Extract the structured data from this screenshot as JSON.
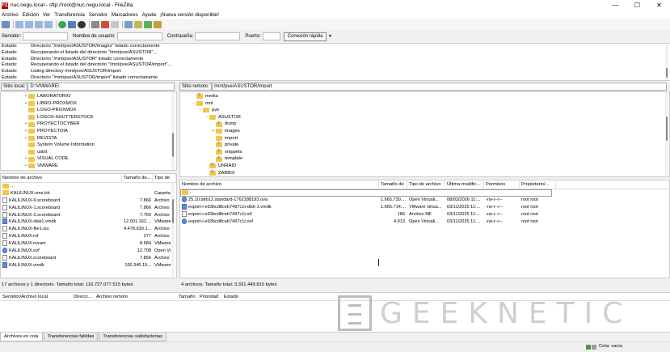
{
  "window": {
    "title": "nuc.negu.local - sftp://root@nuc.negu.local - FileZilla",
    "app_icon": "FZ",
    "minimize": "—",
    "maximize": "☐",
    "close": "✕"
  },
  "menu": [
    "Archivo",
    "Edición",
    "Ver",
    "Transferencia",
    "Servidor",
    "Marcadores",
    "Ayuda",
    "¡Nueva versión disponible!"
  ],
  "quickconnect": {
    "host_label": "Servidor:",
    "user_label": "Nombre de usuario:",
    "pass_label": "Contraseña:",
    "port_label": "Puerto:",
    "button": "Conexión rápida",
    "dropdown": "▼"
  },
  "log": [
    {
      "k": "Estado:",
      "v": "Directorio \"/mnt/pve/ASUSTOR/images\" listado correctamente"
    },
    {
      "k": "Estado:",
      "v": "Recuperando el listado del directorio \"/mnt/pve/ASUSTOR\"..."
    },
    {
      "k": "Estado:",
      "v": "Directorio \"/mnt/pve/ASUSTOR\" listado correctamente"
    },
    {
      "k": "Estado:",
      "v": "Recuperando el listado del directorio \"/mnt/pve/ASUSTOR/import\"..."
    },
    {
      "k": "Estado:",
      "v": "Listing directory /mnt/pve/ASUSTOR/import"
    },
    {
      "k": "Estado:",
      "v": "Directorio \"/mnt/pve/ASUSTOR/import\" listado correctamente"
    }
  ],
  "local": {
    "site_label": "Sitio local:",
    "path": "D:\\VMWARE\\",
    "tree": [
      {
        "name": "LABORATORIO",
        "exp": "+"
      },
      {
        "name": "LIBRO-PROXMOX",
        "exp": "+"
      },
      {
        "name": "LOGO-PROXMOX",
        "exp": ""
      },
      {
        "name": "LOGOS-SHUTTERSTOCK",
        "exp": ""
      },
      {
        "name": "PROYECTOCYBER",
        "exp": "+"
      },
      {
        "name": "PROYECTOIA",
        "exp": "+"
      },
      {
        "name": "REVISTA",
        "exp": "+"
      },
      {
        "name": "System Volume Information",
        "exp": ""
      },
      {
        "name": "usbit",
        "exp": ""
      },
      {
        "name": "VISUAL CODE",
        "exp": "+"
      },
      {
        "name": "VMWARE",
        "exp": "+"
      }
    ],
    "columns": [
      "Nombre de archivo",
      "Tamaño de...",
      "Tipo de"
    ],
    "files": [
      {
        "name": "..",
        "size": "",
        "type": "",
        "icon": "folder"
      },
      {
        "name": "KALILINUX.vmx.lck",
        "size": "",
        "type": "Carpeta",
        "icon": "folder"
      },
      {
        "name": "KALILINUX-0.scoreboard",
        "size": "7.866",
        "type": "Archivo",
        "icon": "file"
      },
      {
        "name": "KALILINUX-1.scoreboard",
        "size": "7.866",
        "type": "Archivo",
        "icon": "file"
      },
      {
        "name": "KALILINUX-2.scoreboard",
        "size": "7.769",
        "type": "Archivo",
        "icon": "file"
      },
      {
        "name": "KALILINUX-disk1.vmdk",
        "size": "12.001.162....",
        "type": "VMware",
        "icon": "disk"
      },
      {
        "name": "KALILINUX-file1.iso",
        "size": "4.478.939.1...",
        "type": "Archivo",
        "icon": "file"
      },
      {
        "name": "KALILINUX.mf",
        "size": "277",
        "type": "Archivo",
        "icon": "file"
      },
      {
        "name": "KALILINUX.nvram",
        "size": "8.684",
        "type": "VMware",
        "icon": "file"
      },
      {
        "name": "KALILINUX.ovf",
        "size": "12.708",
        "type": "Open Vi",
        "icon": "blue"
      },
      {
        "name": "KALILINUX.scoreboard",
        "size": "7.866",
        "type": "Archivo",
        "icon": "file"
      },
      {
        "name": "KALILINUX.vmdk",
        "size": "100.346.15...",
        "type": "VMware",
        "icon": "disk"
      }
    ],
    "status": "17 archivos y 1 directorio. Tamaño total: 116.727.077.515 bytes"
  },
  "remote": {
    "site_label": "Sitio remoto:",
    "path": "/mnt/pve/ASUSTOR/import",
    "tree": [
      {
        "name": "media",
        "exp": "",
        "indent": 1,
        "q": true
      },
      {
        "name": "mnt",
        "exp": "−",
        "indent": 1,
        "q": false
      },
      {
        "name": "pve",
        "exp": "−",
        "indent": 2,
        "q": false
      },
      {
        "name": "ASUSTOR",
        "exp": "−",
        "indent": 3,
        "q": false
      },
      {
        "name": "dump",
        "exp": "",
        "indent": 4,
        "q": true
      },
      {
        "name": "images",
        "exp": "+",
        "indent": 4,
        "q": false
      },
      {
        "name": "import",
        "exp": "",
        "indent": 4,
        "q": false
      },
      {
        "name": "private",
        "exp": "",
        "indent": 4,
        "q": true
      },
      {
        "name": "snippets",
        "exp": "",
        "indent": 4,
        "q": true
      },
      {
        "name": "template",
        "exp": "",
        "indent": 4,
        "q": true
      },
      {
        "name": "UNRAID",
        "exp": "",
        "indent": 3,
        "q": true
      },
      {
        "name": "ZABBIX",
        "exp": "",
        "indent": 3,
        "q": true
      }
    ],
    "columns": [
      "Nombre de archivo",
      "Tamaño de",
      "Tipo de archivo",
      "Última modific...",
      "Permisos",
      "Propietario/..."
    ],
    "files": [
      {
        "name": "..",
        "size": "",
        "type": "",
        "date": "",
        "perm": "",
        "owner": "",
        "icon": "folder"
      },
      {
        "name": "25.10.deb12.standard-1762188193.ova",
        "size": "1.665.730....",
        "type": "Open Virtuali...",
        "date": "08/03/2026 11:...",
        "perm": "-rw-r--r--",
        "owner": "root root",
        "icon": "blue"
      },
      {
        "name": "export-i-e93bcd8ceb7497c1t-disk-1.vmdk",
        "size": "1.665.714....",
        "type": "VMware virtua...",
        "date": "03/11/2025 11:...",
        "perm": "-rw-r--r--",
        "owner": "root root",
        "icon": "disk"
      },
      {
        "name": "export-i-e93bcd8ceb7497c1t.mf",
        "size": "186",
        "type": "Archivo MF",
        "date": "03/11/2025 11:...",
        "perm": "-rw-r--r--",
        "owner": "root root",
        "icon": "file"
      },
      {
        "name": "export-i-e93bcd8ceb7497c1t.ovf",
        "size": "4.913",
        "type": "Open Virtuali...",
        "date": "03/11/2025 11:...",
        "perm": "-rw-r--r--",
        "owner": "root root",
        "icon": "blue"
      }
    ],
    "status": "4 archivos. Tamaño total: 3.331.449.815 bytes"
  },
  "queue": {
    "columns": [
      "Servidor/Archivo local",
      "Direcci...",
      "Archivo remoto",
      "Tamaño",
      "Prioridad",
      "Estado"
    ]
  },
  "tabs": [
    "Archivos en cola",
    "Transferencias fallidas",
    "Transferencias satisfactorias"
  ],
  "bottom": {
    "queue_status": "Cola: vacía"
  },
  "watermark": "GEEKNETIC"
}
